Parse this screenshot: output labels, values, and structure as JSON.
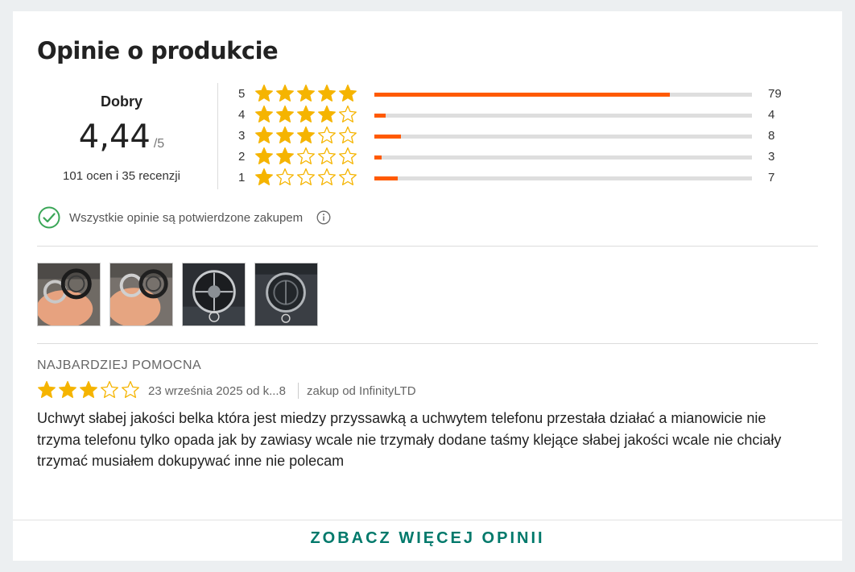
{
  "title": "Opinie o produkcie",
  "summary": {
    "grade": "Dobry",
    "score": "4,44",
    "max": "/5",
    "counts": "101 ocen i 35 recenzji"
  },
  "distribution": [
    {
      "stars": "5",
      "count": "79",
      "filled": 5,
      "fraction": 0.782
    },
    {
      "stars": "4",
      "count": "4",
      "filled": 4,
      "fraction": 0.03
    },
    {
      "stars": "3",
      "count": "8",
      "filled": 3,
      "fraction": 0.07
    },
    {
      "stars": "2",
      "count": "3",
      "filled": 2,
      "fraction": 0.02
    },
    {
      "stars": "1",
      "count": "7",
      "filled": 1,
      "fraction": 0.062
    }
  ],
  "verified": {
    "text": "Wszystkie opinie są potwierdzone zakupem"
  },
  "photos": [
    {
      "alt": "Zdjęcie 1"
    },
    {
      "alt": "Zdjęcie 2"
    },
    {
      "alt": "Zdjęcie 3"
    },
    {
      "alt": "Zdjęcie 4"
    }
  ],
  "review": {
    "heading": "NAJBARDZIEJ POMOCNA",
    "rating": 3,
    "date": "23 września 2025 od k...8",
    "seller": "zakup od InfinityLTD",
    "text": "Uchwyt słabej jakości belka która jest miedzy przyssawką a uchwytem telefonu przestała działać a mianowicie nie trzyma telefonu tylko opada jak by zawiasy wcale nie trzymały dodane taśmy klejące słabej jakości wcale nie chciały trzymać musiałem dokupywać inne nie polecam"
  },
  "more_button": "ZOBACZ WIĘCEJ OPINII",
  "colors": {
    "star": "#f5b400",
    "bar": "#ff5a00",
    "accent": "#00796b",
    "check": "#3aa657"
  },
  "icons": [
    "star-filled-icon",
    "star-empty-icon",
    "check-circle-icon",
    "info-icon"
  ]
}
